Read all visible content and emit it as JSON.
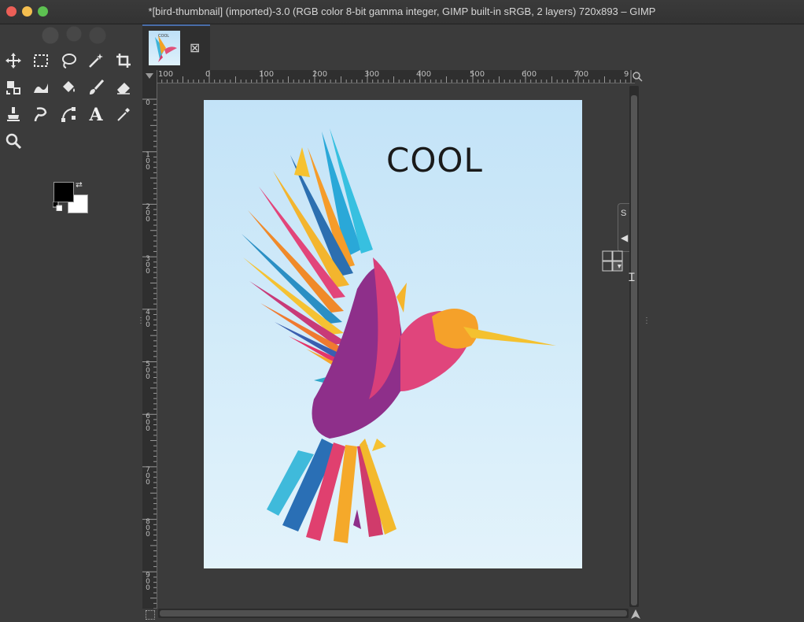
{
  "window": {
    "title": "*[bird-thumbnail] (imported)-3.0 (RGB color 8-bit gamma integer, GIMP built-in sRGB, 2 layers) 720x893 – GIMP"
  },
  "toolbox": {
    "tools": [
      {
        "name": "move-tool-icon"
      },
      {
        "name": "rect-select-tool-icon"
      },
      {
        "name": "free-select-tool-icon"
      },
      {
        "name": "fuzzy-select-tool-icon"
      },
      {
        "name": "crop-tool-icon"
      },
      {
        "name": "unified-transform-tool-icon"
      },
      {
        "name": "warp-transform-tool-icon"
      },
      {
        "name": "bucket-fill-tool-icon"
      },
      {
        "name": "paintbrush-tool-icon"
      },
      {
        "name": "eraser-tool-icon"
      },
      {
        "name": "clone-tool-icon"
      },
      {
        "name": "smudge-tool-icon"
      },
      {
        "name": "paths-tool-icon"
      },
      {
        "name": "text-tool-icon",
        "active": true
      },
      {
        "name": "color-picker-tool-icon"
      },
      {
        "name": "zoom-tool-icon"
      }
    ],
    "fg_color": "#000000",
    "bg_color": "#ffffff"
  },
  "tab": {
    "thumb_text": "COOL",
    "close_glyph": "⊠"
  },
  "rulers": {
    "top_labels": [
      "100",
      "0",
      "100",
      "200",
      "300",
      "400",
      "500",
      "600",
      "700",
      "9"
    ],
    "left_labels": [
      "0",
      "100",
      "200",
      "300",
      "400",
      "500",
      "600",
      "700",
      "800",
      "900"
    ]
  },
  "canvas": {
    "text_layer": "COOL",
    "background_top": "#c3e3f8",
    "background_bottom": "#e3f3fb"
  },
  "dock": {
    "tab_label": "S",
    "tab_arrow": "◀"
  }
}
